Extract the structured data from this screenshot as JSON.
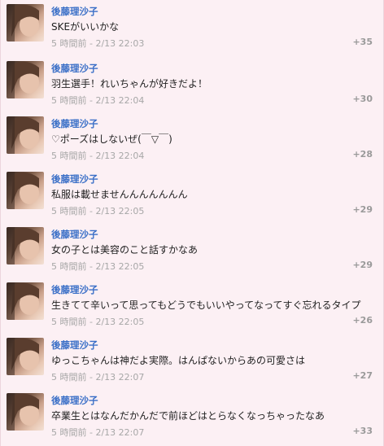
{
  "comments": [
    {
      "author": "後藤理沙子",
      "text": "SKEがいいかな",
      "meta": "5 時間前 - 2/13 22:03",
      "score": "+35"
    },
    {
      "author": "後藤理沙子",
      "text": "羽生選手！れいちゃんが好きだよ！",
      "meta": "5 時間前 - 2/13 22:04",
      "score": "+30"
    },
    {
      "author": "後藤理沙子",
      "text": "♡ポーズはしないぜ(￣▽￣)",
      "meta": "5 時間前 - 2/13 22:04",
      "score": "+28"
    },
    {
      "author": "後藤理沙子",
      "text": "私服は載せませんんんんんんん",
      "meta": "5 時間前 - 2/13 22:05",
      "score": "+29"
    },
    {
      "author": "後藤理沙子",
      "text": "女の子とは美容のこと話すかなあ",
      "meta": "5 時間前 - 2/13 22:05",
      "score": "+29"
    },
    {
      "author": "後藤理沙子",
      "text": "生きてて辛いって思ってもどうでもいいやってなってすぐ忘れるタイプ",
      "meta": "5 時間前 - 2/13 22:05",
      "score": "+26"
    },
    {
      "author": "後藤理沙子",
      "text": "ゆっこちゃんは神だよ実際。はんぱないからあの可愛さは",
      "meta": "5 時間前 - 2/13 22:07",
      "score": "+27"
    },
    {
      "author": "後藤理沙子",
      "text": "卒業生とはなんだかんだで前ほどはとらなくなっちゃったなあ",
      "meta": "5 時間前 - 2/13 22:07",
      "score": "+33"
    }
  ]
}
